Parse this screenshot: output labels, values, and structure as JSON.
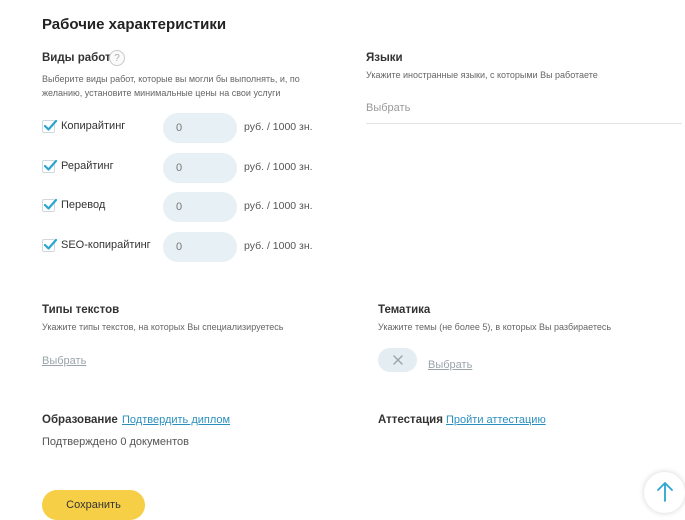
{
  "page": {
    "title": "Рабочие характеристики"
  },
  "work_types": {
    "title": "Виды работ",
    "help": "?",
    "hint_line1": "Выберите виды работ, которые вы могли бы выполнять, и, по",
    "hint_line2": "желанию, установите минимальные цены на свои услуги",
    "items": [
      {
        "label": "Копирайтинг",
        "checked": true,
        "price": "0",
        "unit": "руб. / 1000 зн."
      },
      {
        "label": "Рерайтинг",
        "checked": true,
        "price": "0",
        "unit": "руб. / 1000 зн."
      },
      {
        "label": "Перевод",
        "checked": true,
        "price": "0",
        "unit": "руб. / 1000 зн."
      },
      {
        "label": "SEO-копирайтинг",
        "checked": true,
        "price": "0",
        "unit": "руб. / 1000 зн."
      }
    ]
  },
  "languages": {
    "title": "Языки",
    "hint": "Укажите иностранные языки, с которыми Вы работаете",
    "placeholder": "Выбрать"
  },
  "text_types": {
    "title": "Типы текстов",
    "hint": "Укажите типы текстов, на которых Вы специализируетесь",
    "select_label": "Выбрать"
  },
  "topics": {
    "title": "Тематика",
    "hint": "Укажите темы (не более 5), в которых Вы разбираетесь",
    "select_label": "Выбрать"
  },
  "education": {
    "title": "Образование",
    "link": "Подтвердить диплом",
    "status": "Подтверждено 0 документов"
  },
  "attestation": {
    "title": "Аттестация",
    "link": "Пройти аттестацию"
  },
  "actions": {
    "save_label": "Сохранить"
  },
  "icons": [
    "help-icon",
    "checkmark-icon",
    "close-icon",
    "arrow-up-icon"
  ],
  "colors": {
    "accent": "#2a8fbd",
    "check": "#29a6cf",
    "save_button": "#f7cf46",
    "input_bg": "#e7f0f4"
  }
}
